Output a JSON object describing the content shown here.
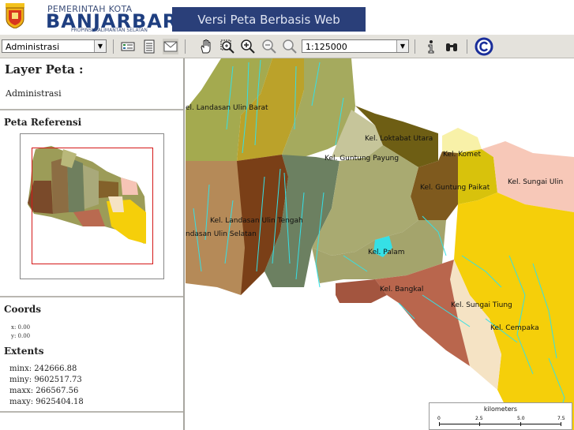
{
  "header": {
    "org_line1": "PEMERINTAH KOTA",
    "org_line2": "BANJARBARU",
    "org_line3": "PROPINSI KALIMANTAN SELATAN",
    "banner": "Versi Peta Berbasis Web"
  },
  "toolbar": {
    "layer_select": "Administrasi",
    "scale_select": "1:125000"
  },
  "left": {
    "layer_title": "Layer Peta :",
    "layer_value": "Administrasi",
    "ref_title": "Peta Referensi",
    "coords_title": "Coords",
    "coord_x": "x: 0.00",
    "coord_y": "y: 0.00",
    "extents_title": "Extents",
    "minx": "minx: 242666.88",
    "miny": "miny: 9602517.73",
    "maxx": "maxx: 266567.56",
    "maxy": "maxy: 9625404.18"
  },
  "map": {
    "labels": {
      "l1": "el. Landasan Ulin Barat",
      "l2": "Kel. Loktabat Utara",
      "l3": "Kel. Komet",
      "l4": "Kel. Guntung Payung",
      "l5": "Kel. Guntung Paikat",
      "l6": "Kel. Sungai Ulin",
      "l7": "Kel. Landasan Ulin Tengah",
      "l8": "ndasan Ulin Selatan",
      "l9": "Kel. Palam",
      "l10": "Kel. Bangkal",
      "l11": "Kel. Sungai Tiung",
      "l12": "Kel. Cempaka"
    },
    "scale": {
      "unit": "kilometers",
      "t0": "0",
      "t1": "2.5",
      "t2": "5.0",
      "t3": "7.5"
    }
  },
  "colors": {
    "banner_bg": "#2a3f79",
    "region_yellow": "#f5cf0a",
    "water": "#35e0e6"
  }
}
